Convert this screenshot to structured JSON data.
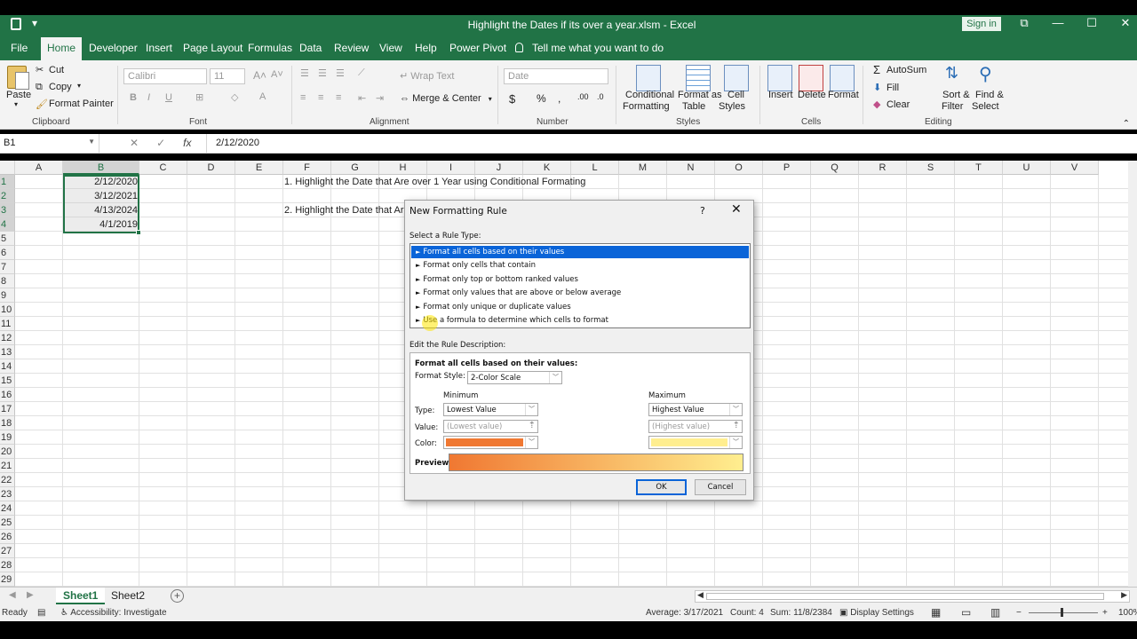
{
  "window": {
    "title": "Highlight the Dates if its over a year.xlsm  -  Excel",
    "signin": "Sign in",
    "minimize": "—",
    "maximize": "☐",
    "close": "✕",
    "qat_more": "▾"
  },
  "tabs": [
    "File",
    "Home",
    "Developer",
    "Insert",
    "Page Layout",
    "Formulas",
    "Data",
    "Review",
    "View",
    "Help",
    "Power Pivot"
  ],
  "tellme": "Tell me what you want to do",
  "ribbon": {
    "clipboard": {
      "label": "Clipboard",
      "paste": "Paste",
      "cut": "Cut",
      "copy": "Copy",
      "format_painter": "Format Painter"
    },
    "font": {
      "label": "Font",
      "name": "Calibri",
      "size": "11"
    },
    "alignment": {
      "label": "Alignment",
      "wrap": "Wrap Text",
      "merge": "Merge & Center"
    },
    "number": {
      "label": "Number",
      "format": "Date"
    },
    "styles": {
      "label": "Styles",
      "conditional": "Conditional",
      "conditional2": "Formatting",
      "format_as": "Format as",
      "format_as2": "Table",
      "cell": "Cell",
      "cell2": "Styles"
    },
    "cells": {
      "label": "Cells",
      "insert": "Insert",
      "delete": "Delete",
      "format": "Format"
    },
    "editing": {
      "label": "Editing",
      "autosum": "AutoSum",
      "fill": "Fill",
      "clear": "Clear",
      "sort": "Sort &",
      "sort2": "Filter",
      "find": "Find &",
      "find2": "Select"
    }
  },
  "formula_bar": {
    "namebox": "B1",
    "formula": "2/12/2020"
  },
  "columns": [
    "A",
    "B",
    "C",
    "D",
    "E",
    "F",
    "G",
    "H",
    "I",
    "J",
    "K",
    "L",
    "M",
    "N",
    "O",
    "P",
    "Q",
    "R",
    "S",
    "T",
    "U",
    "V"
  ],
  "rows": [
    "1",
    "2",
    "3",
    "4",
    "5",
    "6",
    "7",
    "8",
    "9",
    "10",
    "11",
    "12",
    "13",
    "14",
    "15",
    "16",
    "17",
    "18",
    "19",
    "20",
    "21",
    "22",
    "23",
    "24",
    "25",
    "26",
    "27",
    "28",
    "29"
  ],
  "cells": {
    "B1": "2/12/2020",
    "B2": "3/12/2021",
    "B3": "4/13/2024",
    "B4": "4/1/2019",
    "F1": "1. Highlight the Date that Are over 1 Year using Conditional Formating",
    "F3": "2. Highlight the Date that Ar"
  },
  "sheets": [
    "Sheet1",
    "Sheet2"
  ],
  "status": {
    "ready": "Ready",
    "accessibility": "Accessibility: Investigate",
    "average": "Average: 3/17/2021",
    "count": "Count: 4",
    "sum": "Sum: 11/8/2384",
    "display": "Display Settings",
    "zoom": "100%"
  },
  "dialog": {
    "title": "New Formatting Rule",
    "help": "?",
    "close": "✕",
    "select_label": "Select a Rule Type:",
    "rule_types": [
      "Format all cells based on their values",
      "Format only cells that contain",
      "Format only top or bottom ranked values",
      "Format only values that are above or below average",
      "Format only unique or duplicate values",
      "Use a formula to determine which cells to format"
    ],
    "edit_label": "Edit the Rule Description:",
    "desc_heading": "Format all cells based on their values:",
    "format_style_label": "Format Style:",
    "format_style": "2-Color Scale",
    "minimum": "Minimum",
    "maximum": "Maximum",
    "type_label": "Type:",
    "value_label": "Value:",
    "color_label": "Color:",
    "min_type": "Lowest Value",
    "max_type": "Highest Value",
    "min_value": "(Lowest value)",
    "max_value": "(Highest value)",
    "min_color": "#f07832",
    "max_color": "#ffee8f",
    "preview_label": "Preview:",
    "ok": "OK",
    "cancel": "Cancel"
  }
}
